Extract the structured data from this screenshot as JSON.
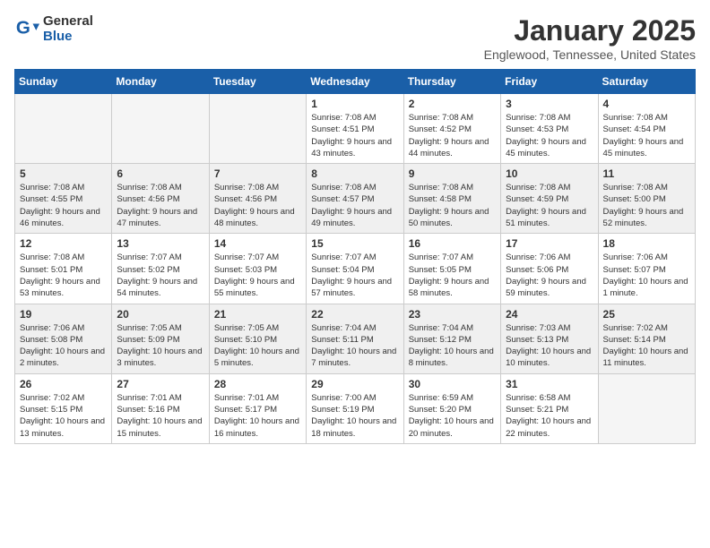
{
  "header": {
    "logo_general": "General",
    "logo_blue": "Blue",
    "month": "January 2025",
    "location": "Englewood, Tennessee, United States"
  },
  "weekdays": [
    "Sunday",
    "Monday",
    "Tuesday",
    "Wednesday",
    "Thursday",
    "Friday",
    "Saturday"
  ],
  "weeks": [
    [
      {
        "day": "",
        "empty": true
      },
      {
        "day": "",
        "empty": true
      },
      {
        "day": "",
        "empty": true
      },
      {
        "day": "1",
        "sunrise": "7:08 AM",
        "sunset": "4:51 PM",
        "daylight": "9 hours and 43 minutes."
      },
      {
        "day": "2",
        "sunrise": "7:08 AM",
        "sunset": "4:52 PM",
        "daylight": "9 hours and 44 minutes."
      },
      {
        "day": "3",
        "sunrise": "7:08 AM",
        "sunset": "4:53 PM",
        "daylight": "9 hours and 45 minutes."
      },
      {
        "day": "4",
        "sunrise": "7:08 AM",
        "sunset": "4:54 PM",
        "daylight": "9 hours and 45 minutes."
      }
    ],
    [
      {
        "day": "5",
        "sunrise": "7:08 AM",
        "sunset": "4:55 PM",
        "daylight": "9 hours and 46 minutes."
      },
      {
        "day": "6",
        "sunrise": "7:08 AM",
        "sunset": "4:56 PM",
        "daylight": "9 hours and 47 minutes."
      },
      {
        "day": "7",
        "sunrise": "7:08 AM",
        "sunset": "4:56 PM",
        "daylight": "9 hours and 48 minutes."
      },
      {
        "day": "8",
        "sunrise": "7:08 AM",
        "sunset": "4:57 PM",
        "daylight": "9 hours and 49 minutes."
      },
      {
        "day": "9",
        "sunrise": "7:08 AM",
        "sunset": "4:58 PM",
        "daylight": "9 hours and 50 minutes."
      },
      {
        "day": "10",
        "sunrise": "7:08 AM",
        "sunset": "4:59 PM",
        "daylight": "9 hours and 51 minutes."
      },
      {
        "day": "11",
        "sunrise": "7:08 AM",
        "sunset": "5:00 PM",
        "daylight": "9 hours and 52 minutes."
      }
    ],
    [
      {
        "day": "12",
        "sunrise": "7:08 AM",
        "sunset": "5:01 PM",
        "daylight": "9 hours and 53 minutes."
      },
      {
        "day": "13",
        "sunrise": "7:07 AM",
        "sunset": "5:02 PM",
        "daylight": "9 hours and 54 minutes."
      },
      {
        "day": "14",
        "sunrise": "7:07 AM",
        "sunset": "5:03 PM",
        "daylight": "9 hours and 55 minutes."
      },
      {
        "day": "15",
        "sunrise": "7:07 AM",
        "sunset": "5:04 PM",
        "daylight": "9 hours and 57 minutes."
      },
      {
        "day": "16",
        "sunrise": "7:07 AM",
        "sunset": "5:05 PM",
        "daylight": "9 hours and 58 minutes."
      },
      {
        "day": "17",
        "sunrise": "7:06 AM",
        "sunset": "5:06 PM",
        "daylight": "9 hours and 59 minutes."
      },
      {
        "day": "18",
        "sunrise": "7:06 AM",
        "sunset": "5:07 PM",
        "daylight": "10 hours and 1 minute."
      }
    ],
    [
      {
        "day": "19",
        "sunrise": "7:06 AM",
        "sunset": "5:08 PM",
        "daylight": "10 hours and 2 minutes."
      },
      {
        "day": "20",
        "sunrise": "7:05 AM",
        "sunset": "5:09 PM",
        "daylight": "10 hours and 3 minutes."
      },
      {
        "day": "21",
        "sunrise": "7:05 AM",
        "sunset": "5:10 PM",
        "daylight": "10 hours and 5 minutes."
      },
      {
        "day": "22",
        "sunrise": "7:04 AM",
        "sunset": "5:11 PM",
        "daylight": "10 hours and 7 minutes."
      },
      {
        "day": "23",
        "sunrise": "7:04 AM",
        "sunset": "5:12 PM",
        "daylight": "10 hours and 8 minutes."
      },
      {
        "day": "24",
        "sunrise": "7:03 AM",
        "sunset": "5:13 PM",
        "daylight": "10 hours and 10 minutes."
      },
      {
        "day": "25",
        "sunrise": "7:02 AM",
        "sunset": "5:14 PM",
        "daylight": "10 hours and 11 minutes."
      }
    ],
    [
      {
        "day": "26",
        "sunrise": "7:02 AM",
        "sunset": "5:15 PM",
        "daylight": "10 hours and 13 minutes."
      },
      {
        "day": "27",
        "sunrise": "7:01 AM",
        "sunset": "5:16 PM",
        "daylight": "10 hours and 15 minutes."
      },
      {
        "day": "28",
        "sunrise": "7:01 AM",
        "sunset": "5:17 PM",
        "daylight": "10 hours and 16 minutes."
      },
      {
        "day": "29",
        "sunrise": "7:00 AM",
        "sunset": "5:19 PM",
        "daylight": "10 hours and 18 minutes."
      },
      {
        "day": "30",
        "sunrise": "6:59 AM",
        "sunset": "5:20 PM",
        "daylight": "10 hours and 20 minutes."
      },
      {
        "day": "31",
        "sunrise": "6:58 AM",
        "sunset": "5:21 PM",
        "daylight": "10 hours and 22 minutes."
      },
      {
        "day": "",
        "empty": true
      }
    ]
  ]
}
